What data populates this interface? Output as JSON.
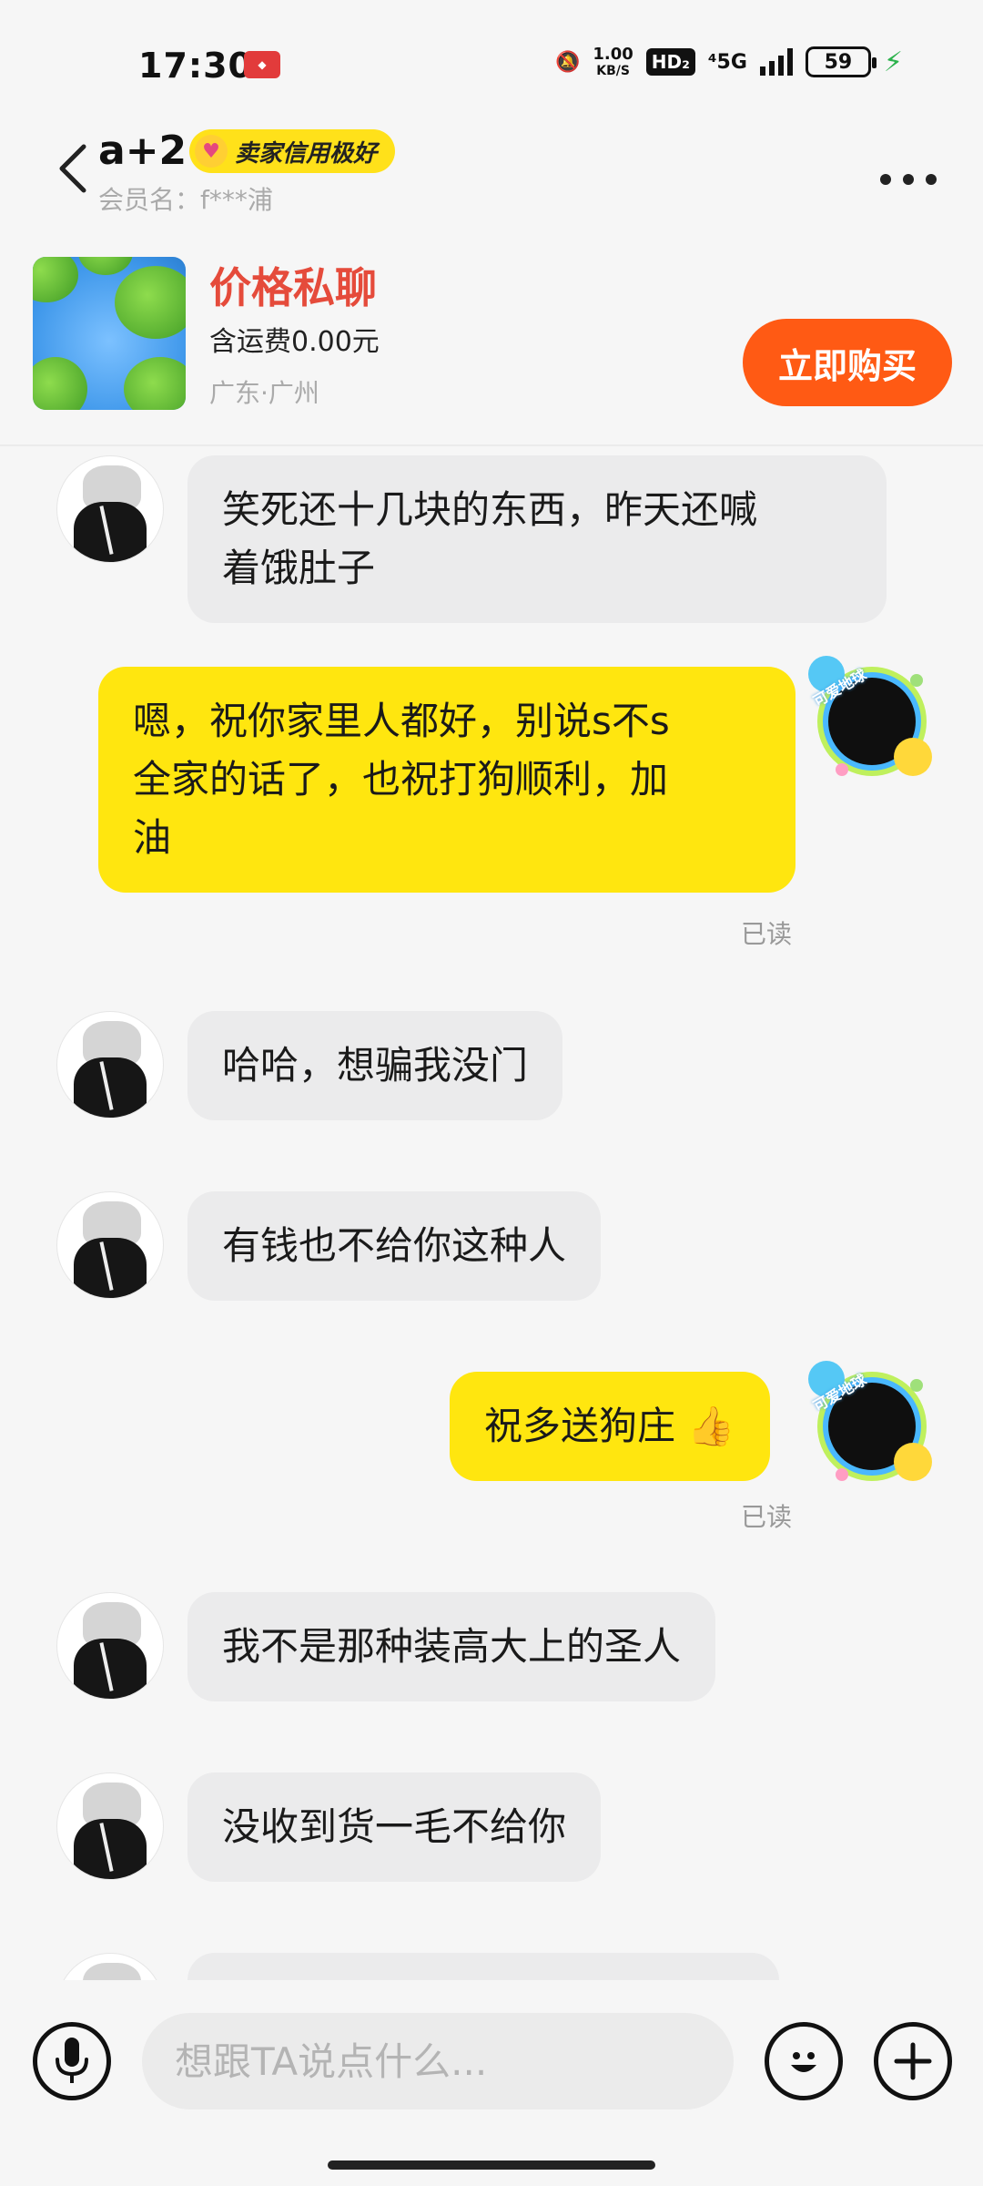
{
  "status_bar": {
    "time": "17:30",
    "speed_value": "1.00",
    "speed_unit": "KB/S",
    "hd": "HD₂",
    "network": "⁴5G",
    "battery": "59"
  },
  "header": {
    "back_icon": "chevron-left-icon",
    "nickname": "a+2",
    "credit_badge": "卖家信用极好",
    "member_label": "会员名：f***浦",
    "more_icon": "more-dots-icon"
  },
  "product": {
    "price": "价格私聊",
    "shipping": "含运费0.00元",
    "location": "广东·广州",
    "buy_button": "立即购买"
  },
  "messages": [
    {
      "side": "left",
      "text_lines": [
        "笑死还十几块的东西，昨天还喊",
        "着饿肚子"
      ]
    },
    {
      "side": "right",
      "text_lines": [
        "嗯，祝你家里人都好，别说s不s",
        "全家的话了，也祝打狗顺利，加",
        "油"
      ],
      "status": "已读"
    },
    {
      "side": "left",
      "text": "哈哈，想骗我没门"
    },
    {
      "side": "left",
      "text": "有钱也不给你这种人"
    },
    {
      "side": "right",
      "text": "祝多送狗庄",
      "emoji": "👍",
      "status": "已读"
    },
    {
      "side": "left",
      "text": "我不是那种装高大上的圣人"
    },
    {
      "side": "left",
      "text": "没收到货一毛不给你"
    }
  ],
  "avatar_right_label": "可爱地球",
  "input": {
    "placeholder": "想跟TA说点什么...",
    "voice_icon": "microphone-icon",
    "emoji_icon": "emoji-icon",
    "plus_icon": "plus-icon"
  },
  "colors": {
    "accent": "#ff5a14",
    "price": "#e54b3b",
    "my_bubble": "#ffe60f",
    "their_bubble": "#ebebec",
    "credit_badge": "#ffe11a"
  }
}
